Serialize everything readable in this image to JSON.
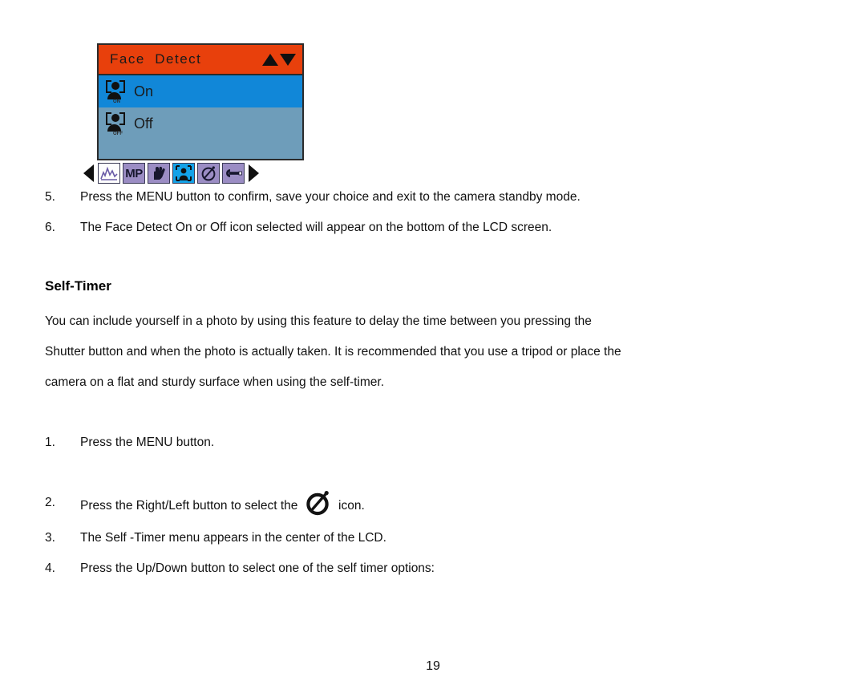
{
  "lcd": {
    "menu_title": "Face  Detect",
    "header_arrows": [
      "up-triangle",
      "down-triangle"
    ],
    "options": [
      {
        "label": "On",
        "icon_tag": "ON",
        "state": "selected"
      },
      {
        "label": "Off",
        "icon_tag": "OFF",
        "state": "unselected"
      }
    ],
    "toolbar": {
      "nav_left": "left-arrow",
      "nav_right": "right-arrow",
      "items": [
        {
          "name": "scene-histogram-icon",
          "label": "",
          "style": "white-bg"
        },
        {
          "name": "megapixel-icon",
          "label": "MP",
          "style": "purple-bg"
        },
        {
          "name": "anti-shake-hand-icon",
          "label": "",
          "style": "purple-bg"
        },
        {
          "name": "face-detect-icon",
          "label": "",
          "style": "active-bg"
        },
        {
          "name": "self-timer-icon",
          "label": "",
          "style": "purple-bg"
        },
        {
          "name": "setup-wrench-icon",
          "label": "",
          "style": "purple-bg"
        }
      ]
    },
    "colors": {
      "header_bg": "#e8400c",
      "selected_row_bg": "#1187d8",
      "unselected_row_bg": "#6e9dba",
      "toolbar_purple": "#9b8dc4",
      "toolbar_active": "#13a2e8"
    }
  },
  "face_detect_steps": [
    {
      "num": "5.",
      "text": "Press the MENU button to confirm, save your choice and exit to the camera standby mode."
    },
    {
      "num": "6.",
      "text": "The Face Detect On or Off icon selected will appear on the bottom of the LCD screen."
    }
  ],
  "self_timer": {
    "heading": "Self-Timer",
    "paragraph_lines": [
      "You can include yourself in a photo by using this feature to delay the time between you pressing the",
      "Shutter button and when the photo is actually taken. It is recommended that you use a tripod or place the",
      "camera on a flat and sturdy surface when using the self-timer."
    ],
    "steps": [
      {
        "num": "1.",
        "text": "Press the MENU button.",
        "icon": null,
        "text_after": ""
      },
      {
        "num": "2.",
        "text": "Press the Right/Left button to select the",
        "icon": "self-timer-icon",
        "text_after": "icon."
      },
      {
        "num": "3.",
        "text": "The Self -Timer menu appears in the center of the LCD.",
        "icon": null,
        "text_after": ""
      },
      {
        "num": "4.",
        "text": "Press the Up/Down button to select one of the self timer options:",
        "icon": null,
        "text_after": ""
      }
    ]
  },
  "footer": {
    "page_number": "19"
  }
}
